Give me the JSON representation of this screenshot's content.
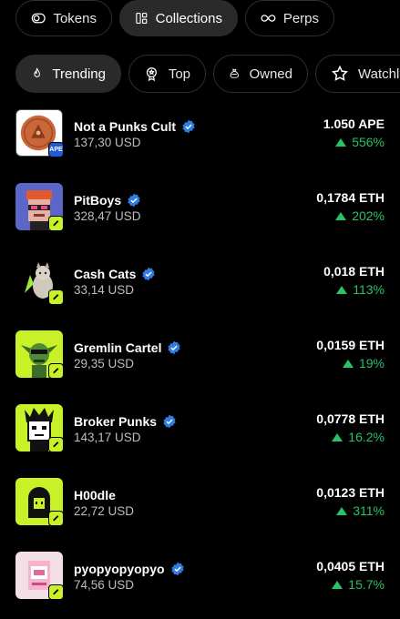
{
  "top_tabs": [
    {
      "label": "Tokens",
      "icon": "toggle-icon"
    },
    {
      "label": "Collections",
      "icon": "grid-icon",
      "active": true
    },
    {
      "label": "Perps",
      "icon": "infinity-icon"
    }
  ],
  "filters": [
    {
      "label": "Trending",
      "icon": "flame-icon",
      "active": true
    },
    {
      "label": "Top",
      "icon": "medal-icon"
    },
    {
      "label": "Owned",
      "icon": "bag-icon"
    },
    {
      "label": "Watchlist",
      "icon": "star-icon"
    }
  ],
  "collections": [
    {
      "name": "Not a Punks Cult",
      "usd": "137,30 USD",
      "price": "1.050 APE",
      "change": "556%",
      "chain_badge": "APE",
      "badge_icon": "ape-badge"
    },
    {
      "name": "PitBoys",
      "usd": "328,47 USD",
      "price": "0,1784 ETH",
      "change": "202%",
      "badge_icon": "ethereum-icon"
    },
    {
      "name": "Cash Cats",
      "usd": "33,14 USD",
      "price": "0,018 ETH",
      "change": "113%",
      "badge_icon": "ethereum-icon"
    },
    {
      "name": "Gremlin Cartel",
      "usd": "29,35 USD",
      "price": "0,0159 ETH",
      "change": "19%",
      "badge_icon": "ethereum-icon"
    },
    {
      "name": "Broker Punks",
      "usd": "143,17 USD",
      "price": "0,0778 ETH",
      "change": "16.2%",
      "badge_icon": "ethereum-icon"
    },
    {
      "name": "H00dle",
      "usd": "22,72 USD",
      "price": "0,0123 ETH",
      "change": "311%",
      "badge_icon": "ethereum-icon"
    },
    {
      "name": "pyopyopyopyo",
      "usd": "74,56 USD",
      "price": "0,0405 ETH",
      "change": "15.7%",
      "badge_icon": "ethereum-icon"
    }
  ],
  "colors": {
    "background": "#000000",
    "positive": "#29c266",
    "verified": "#2f7de1",
    "eth_badge": "#c8f227",
    "ape_badge": "#1f5bd6"
  }
}
